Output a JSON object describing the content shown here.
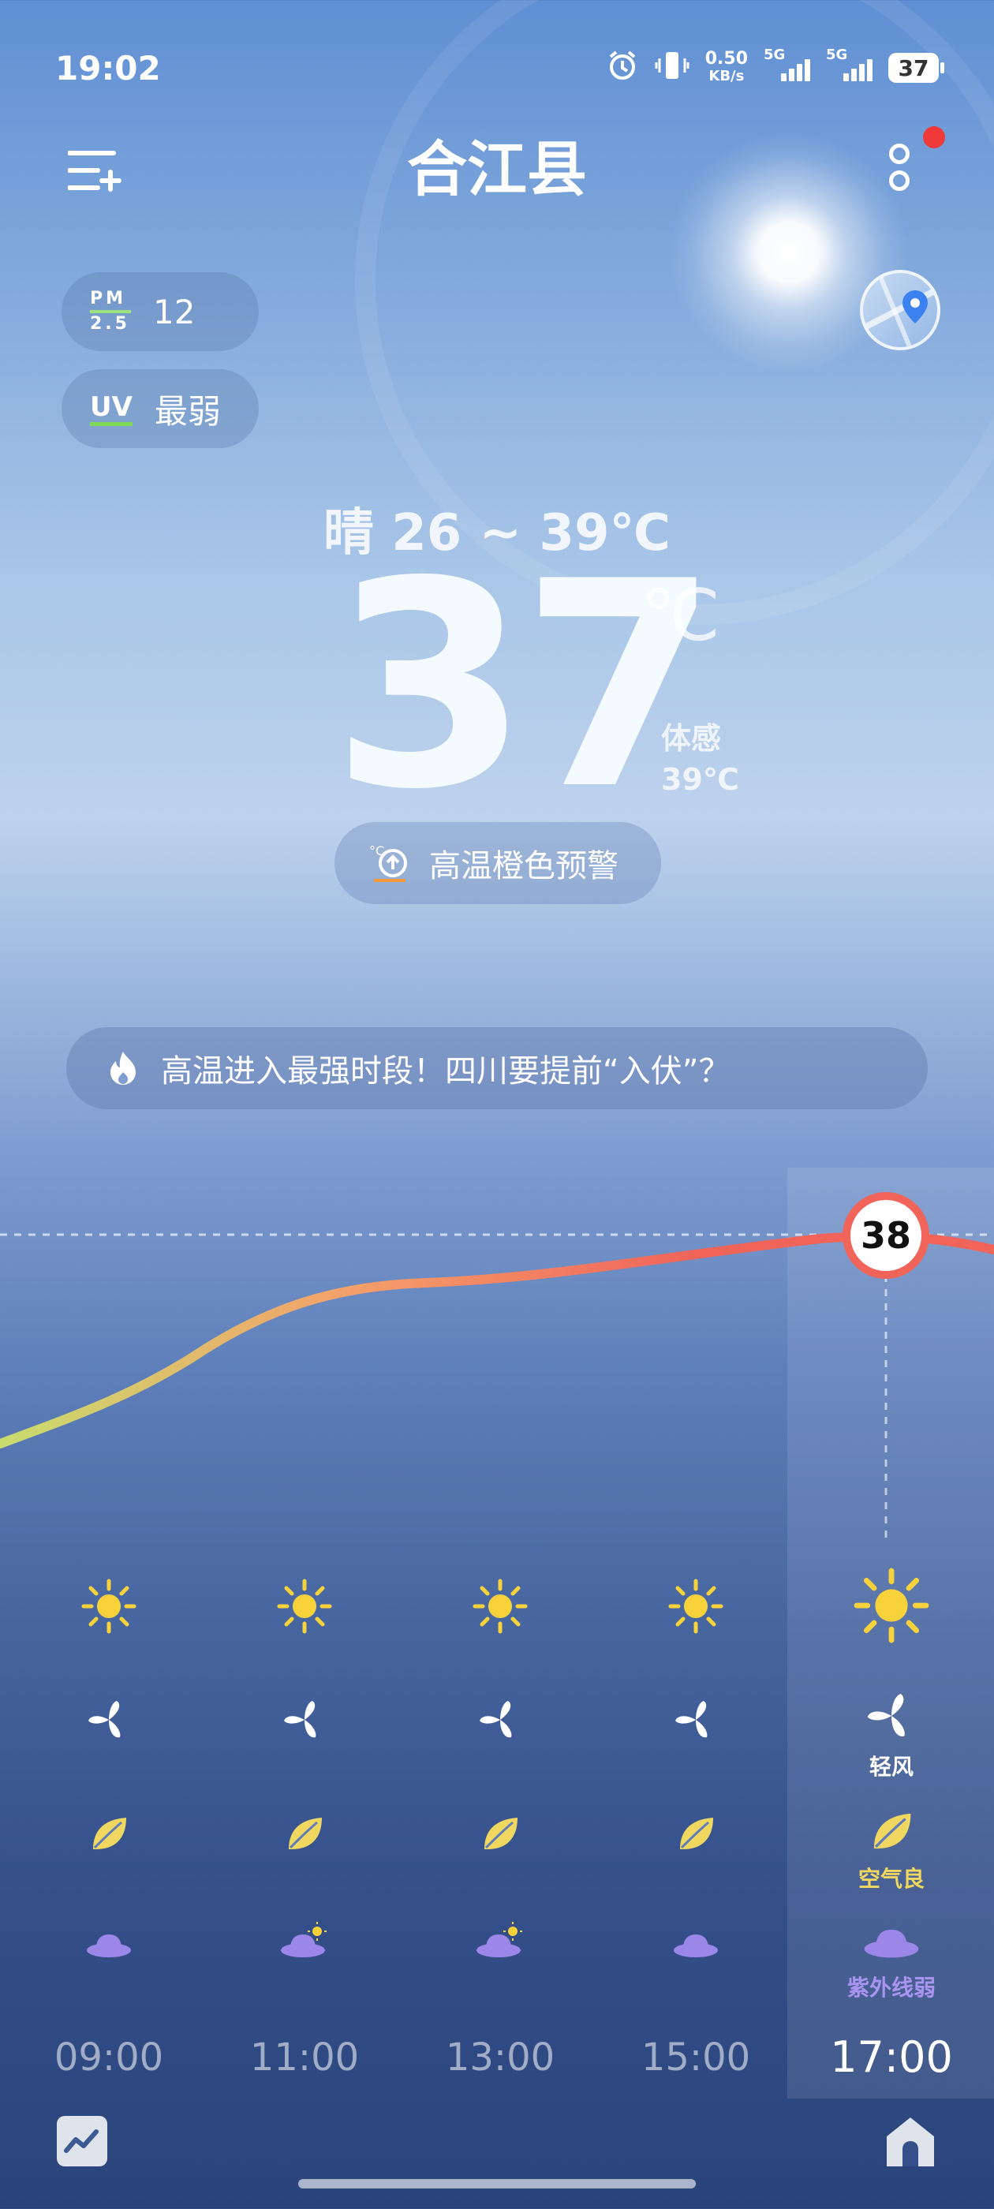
{
  "status_bar": {
    "time": "19:02",
    "net_speed_value": "0.50",
    "net_speed_unit": "KB/s",
    "signal1_label": "5G",
    "signal2_label": "5G",
    "battery": "37"
  },
  "header": {
    "city": "合江县"
  },
  "pm25": {
    "label_top": "PM",
    "label_bottom": "2.5",
    "value": "12"
  },
  "uv": {
    "label": "UV",
    "value": "最弱"
  },
  "current": {
    "condition_range": "晴  26 ~ 39℃",
    "temp": "37",
    "unit": "℃",
    "feels_label": "体感",
    "feels_value": "39℃"
  },
  "alert": {
    "text": "高温橙色预警"
  },
  "news": {
    "text": "高温进入最强时段！四川要提前“入伏”？"
  },
  "hourly": {
    "highlight_temp": "38",
    "wind_label": "轻风",
    "air_label": "空气良",
    "uv_label": "紫外线弱",
    "hours": [
      "09:00",
      "11:00",
      "13:00",
      "15:00",
      "17:00"
    ]
  },
  "chart_data": {
    "type": "line",
    "x": [
      "09:00",
      "11:00",
      "13:00",
      "15:00",
      "17:00"
    ],
    "values": [
      null,
      null,
      null,
      null,
      38
    ],
    "highlight_index": 4,
    "colors": {
      "start": "#c8dc6e",
      "mid": "#f4a06a",
      "end": "#f0645a"
    }
  },
  "colors": {
    "sun": "#f7d23a",
    "leaf": "#f0d860",
    "hat": "#9b87e8",
    "red_dot": "#f03a3a"
  }
}
